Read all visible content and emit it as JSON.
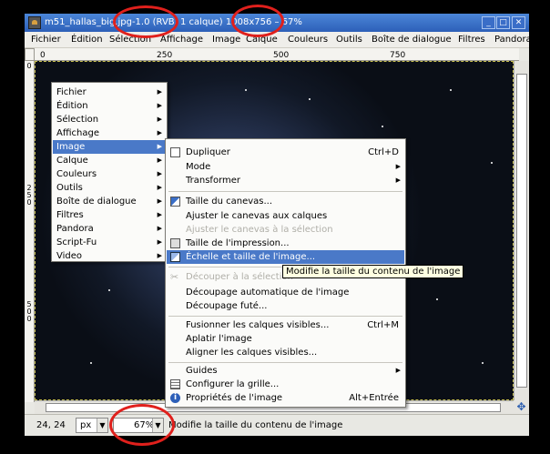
{
  "window": {
    "title": "m51_hallas_big.jpg-1.0 (RVB, 1 calque) 1008x756 – 67%",
    "buttons": [
      "_",
      "□",
      "✕"
    ]
  },
  "menubar": [
    "Fichier",
    "Édition",
    "Sélection",
    "Affichage",
    "Image",
    "Calque",
    "Couleurs",
    "Outils",
    "Boîte de dialogue",
    "Filtres",
    "Pandora"
  ],
  "ruler": {
    "h_ticks": [
      "0",
      "250",
      "500",
      "750"
    ],
    "v_ticks": [
      "0",
      "250",
      "500"
    ]
  },
  "context_menu": {
    "items": [
      "Fichier",
      "Édition",
      "Sélection",
      "Affichage",
      "Image",
      "Calque",
      "Couleurs",
      "Outils",
      "Boîte de dialogue",
      "Filtres",
      "Pandora",
      "Script-Fu",
      "Video"
    ],
    "active": "Image"
  },
  "image_menu": {
    "dupliquer": {
      "label": "Dupliquer",
      "shortcut": "Ctrl+D"
    },
    "mode": "Mode",
    "transformer": "Transformer",
    "taille_canevas": "Taille du canevas...",
    "ajuster_canevas": "Ajuster le canevas aux calques",
    "ajuster_selection": "Ajuster le canevas à la sélection",
    "taille_impression": "Taille de l'impression...",
    "echelle": "Échelle et taille de l'image...",
    "decouper_selection": "Découper à la sélection",
    "decoupage_auto": "Découpage automatique de l'image",
    "decoupage_fute": "Découpage futé...",
    "fusionner": {
      "label": "Fusionner les calques visibles...",
      "shortcut": "Ctrl+M"
    },
    "aplatir": "Aplatir l'image",
    "aligner": "Aligner les calques visibles...",
    "guides": "Guides",
    "grille": "Configurer la grille...",
    "proprietes": {
      "label": "Propriétés de l'image",
      "shortcut": "Alt+Entrée"
    }
  },
  "tooltip": "Modifie la taille du contenu de l'image",
  "statusbar": {
    "coords": "24, 24",
    "unit": "px",
    "zoom": "67%",
    "message": "Modifie la taille du contenu de l'image"
  },
  "colors": {
    "title_bar": "#2d5fb8",
    "menu_highlight": "#4a79c8",
    "annotation_circle": "#e0201c"
  }
}
